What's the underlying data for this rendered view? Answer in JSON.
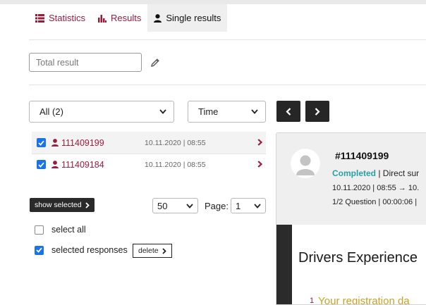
{
  "tabs": [
    {
      "label": "Statistics",
      "icon": "list-icon"
    },
    {
      "label": "Results",
      "icon": "bar-chart-icon"
    },
    {
      "label": "Single results",
      "icon": "user-icon",
      "active": true
    }
  ],
  "filter": {
    "total_placeholder": "Total result",
    "respondent_filter": "All (2)",
    "sort": "Time"
  },
  "results": [
    {
      "id": "111409199",
      "date": "10.11.2020 | 08:55",
      "checked": true
    },
    {
      "id": "111409184",
      "date": "10.11.2020 | 08:55",
      "checked": true
    }
  ],
  "list_controls": {
    "show_selected_label": "show selected",
    "per_page": "50",
    "page_label": "Page:",
    "page": "1",
    "select_all_label": "select all",
    "selected_responses_label": "selected responses",
    "delete_label": "delete"
  },
  "detail": {
    "id": "#111409199",
    "status": "Completed",
    "status_rest": "| Direct sur",
    "timeline": "10.11.2020 | 08:55 → 10.",
    "progress": "1/2 Question | 00:00:06 |",
    "survey_title": "Drivers Experience",
    "question_number": "1",
    "question_text": "Your registration da"
  },
  "colors": {
    "accent": "#9b1b3c",
    "completed": "#2aa0a0",
    "checkbox": "#1a73e8",
    "question": "#c9a227"
  }
}
